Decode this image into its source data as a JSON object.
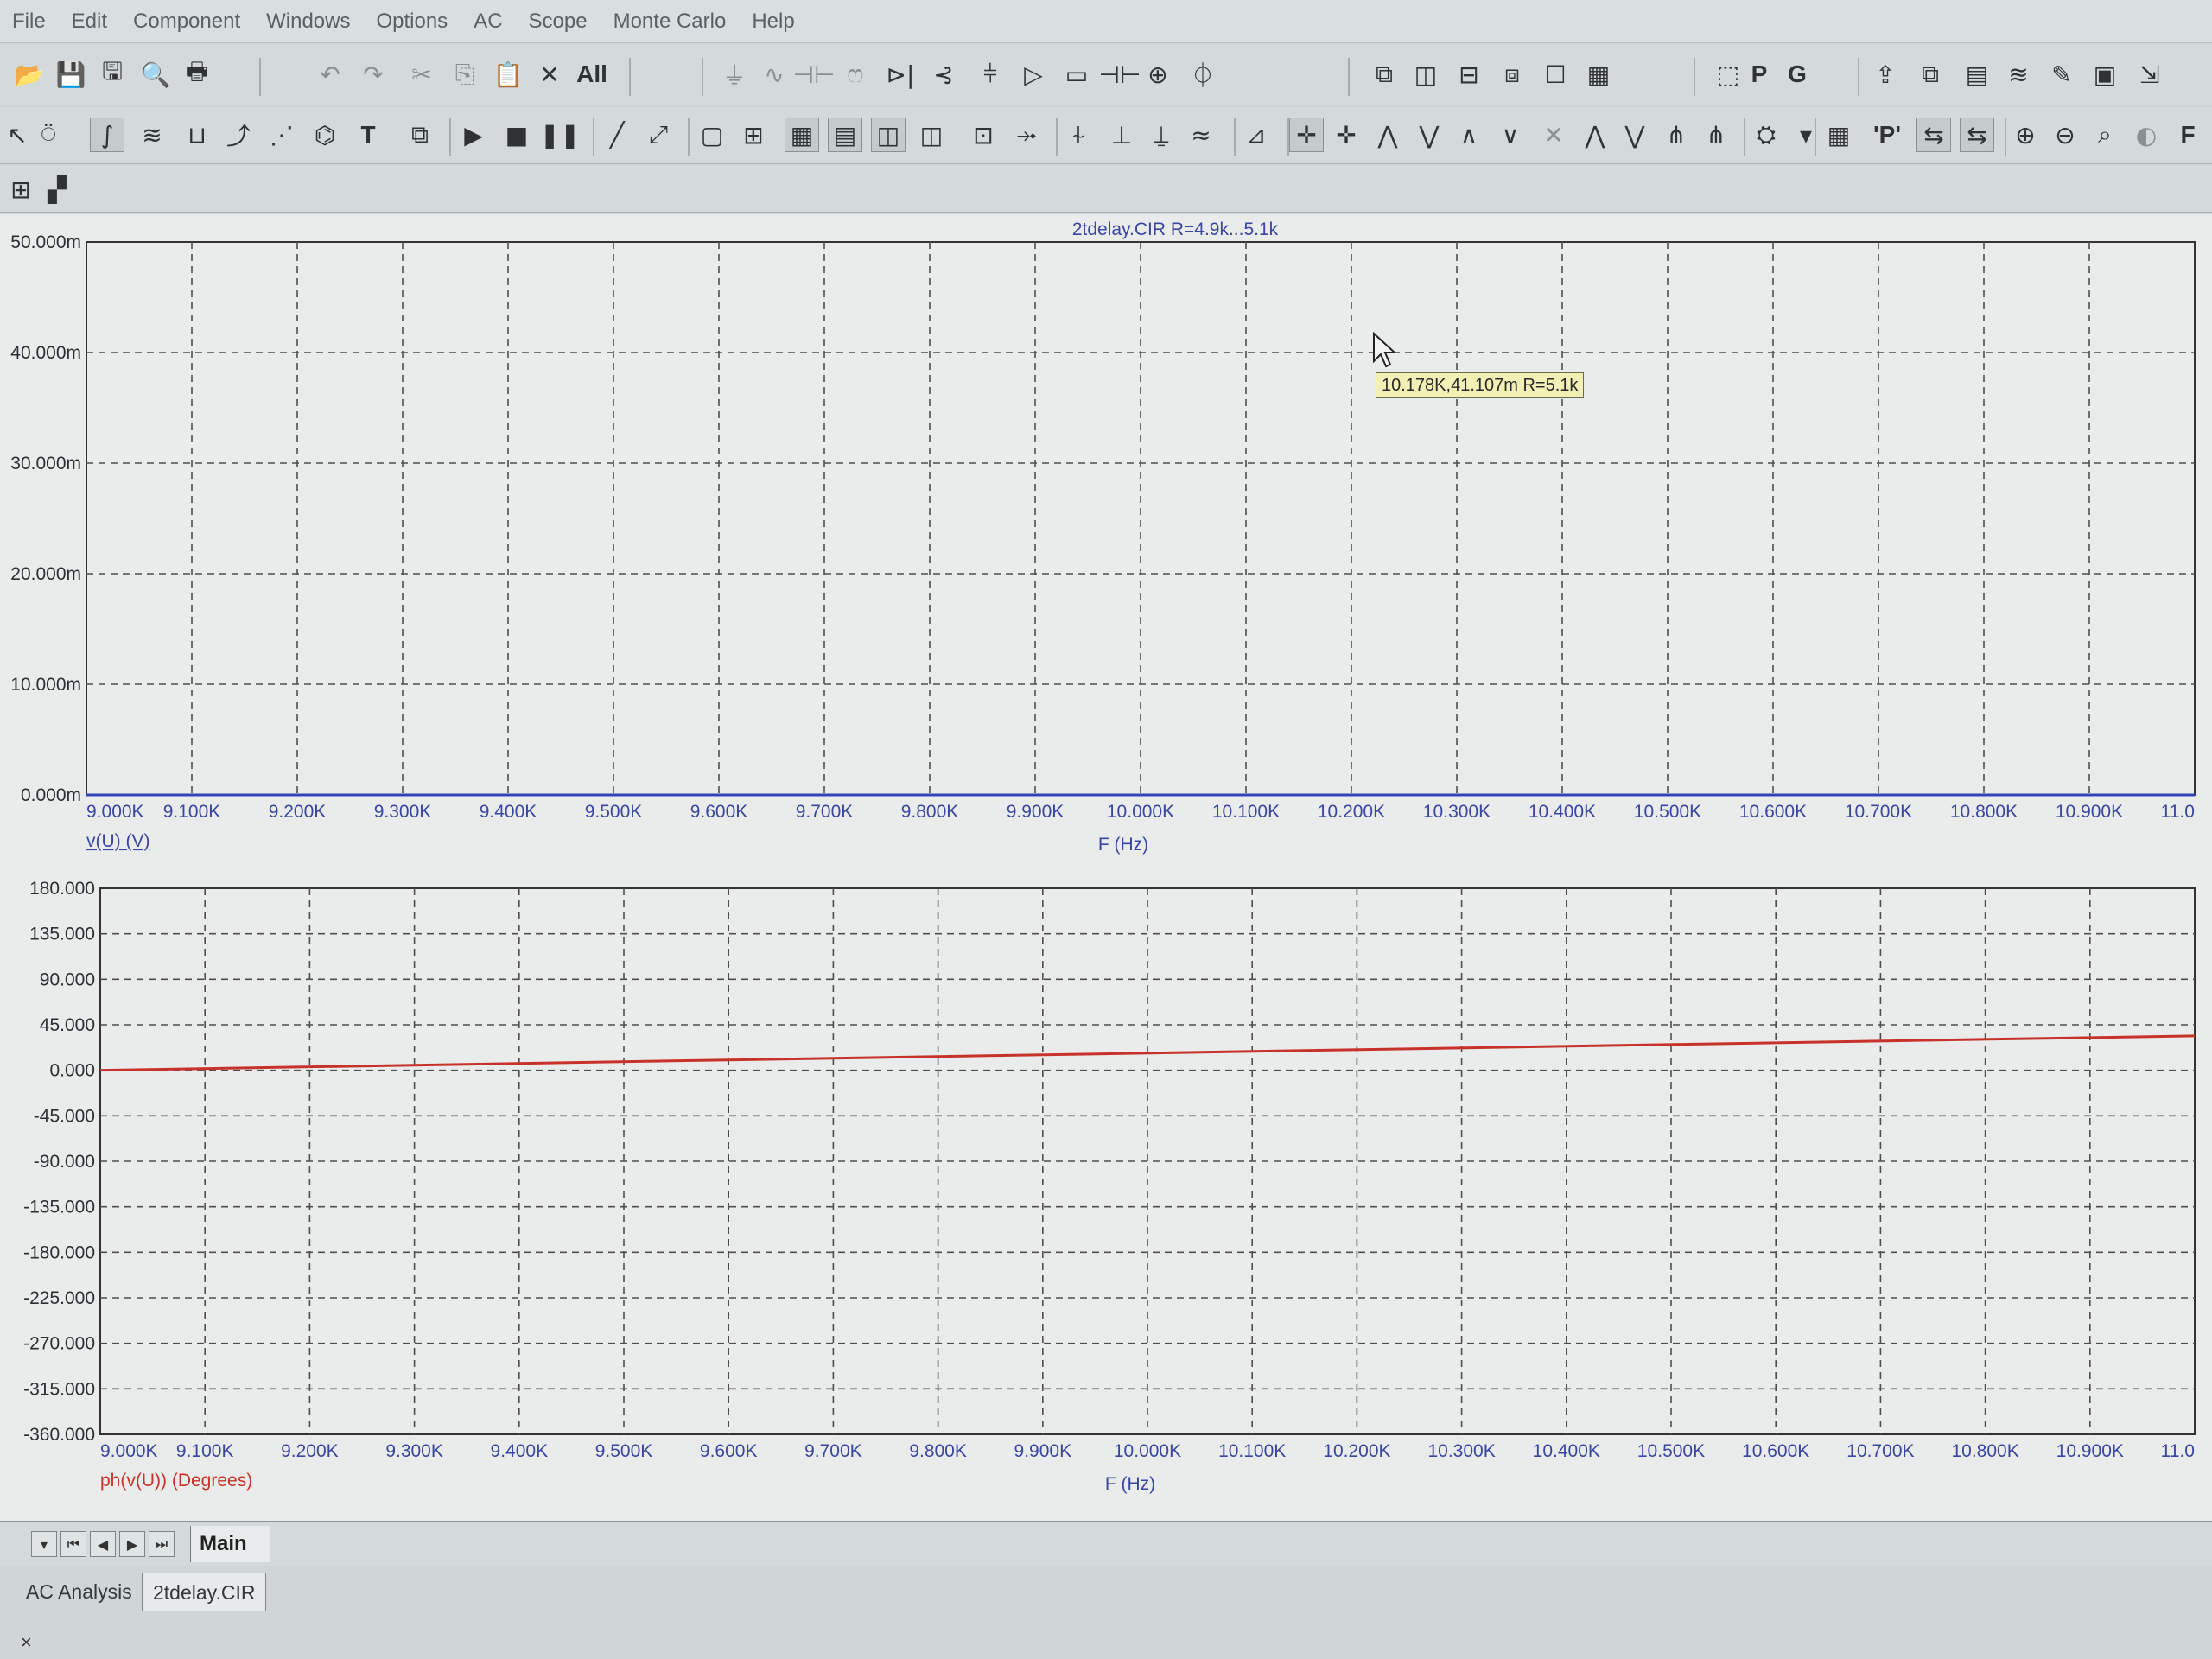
{
  "menu": [
    "File",
    "Edit",
    "Component",
    "Windows",
    "Options",
    "AC",
    "Scope",
    "Monte Carlo",
    "Help"
  ],
  "toolbar": {
    "label_all": "All",
    "label_p": "P",
    "label_g": "G",
    "label_text": "T",
    "label_p_quote": "'P'",
    "label_f": "F"
  },
  "tooltip": {
    "text": "10.178K,41.107m R=5.1k"
  },
  "tabs": {
    "sheet": "Main"
  },
  "status_tabs": [
    "AC Analysis",
    "2tdelay.CIR"
  ],
  "status_close": "×",
  "colors": {
    "grid": "#4e4e4e",
    "x_label_blue": "#3a46a0",
    "phase_red": "#c8322a",
    "magnitude_blue": "#3344b8"
  },
  "chart_data": [
    {
      "type": "line",
      "title": "2tdelay.CIR R=4.9k...5.1k",
      "xlabel": "F (Hz)",
      "ylabel": "v(U) (V)",
      "x_ticks": [
        "9.000K",
        "9.100K",
        "9.200K",
        "9.300K",
        "9.400K",
        "9.500K",
        "9.600K",
        "9.700K",
        "9.800K",
        "9.900K",
        "10.000K",
        "10.100K",
        "10.200K",
        "10.300K",
        "10.400K",
        "10.500K",
        "10.600K",
        "10.700K",
        "10.800K",
        "10.900K",
        "11.0"
      ],
      "y_ticks": [
        "0.000m",
        "10.000m",
        "20.000m",
        "30.000m",
        "40.000m",
        "50.000m"
      ],
      "xlim": [
        9000,
        11000
      ],
      "ylim": [
        0,
        0.05
      ],
      "grid": true,
      "series": [
        {
          "name": "v(U) (V)",
          "color": "#3344b8",
          "x": [
            9000,
            11000
          ],
          "y": [
            0.0,
            0.0
          ]
        }
      ]
    },
    {
      "type": "line",
      "xlabel": "F (Hz)",
      "ylabel": "ph(v(U)) (Degrees)",
      "x_ticks": [
        "9.000K",
        "9.100K",
        "9.200K",
        "9.300K",
        "9.400K",
        "9.500K",
        "9.600K",
        "9.700K",
        "9.800K",
        "9.900K",
        "10.000K",
        "10.100K",
        "10.200K",
        "10.300K",
        "10.400K",
        "10.500K",
        "10.600K",
        "10.700K",
        "10.800K",
        "10.900K",
        "11.0"
      ],
      "y_ticks": [
        "180.000",
        "135.000",
        "90.000",
        "45.000",
        "0.000",
        "-45.000",
        "-90.000",
        "-135.000",
        "-180.000",
        "-225.000",
        "-270.000",
        "-315.000",
        "-360.000"
      ],
      "xlim": [
        9000,
        11000
      ],
      "ylim": [
        -360,
        180
      ],
      "grid": true,
      "series": [
        {
          "name": "ph(v(U)) (Degrees)",
          "color": "#c8322a",
          "x": [
            9000,
            11000
          ],
          "y": [
            0.0,
            34.0
          ]
        }
      ]
    }
  ]
}
